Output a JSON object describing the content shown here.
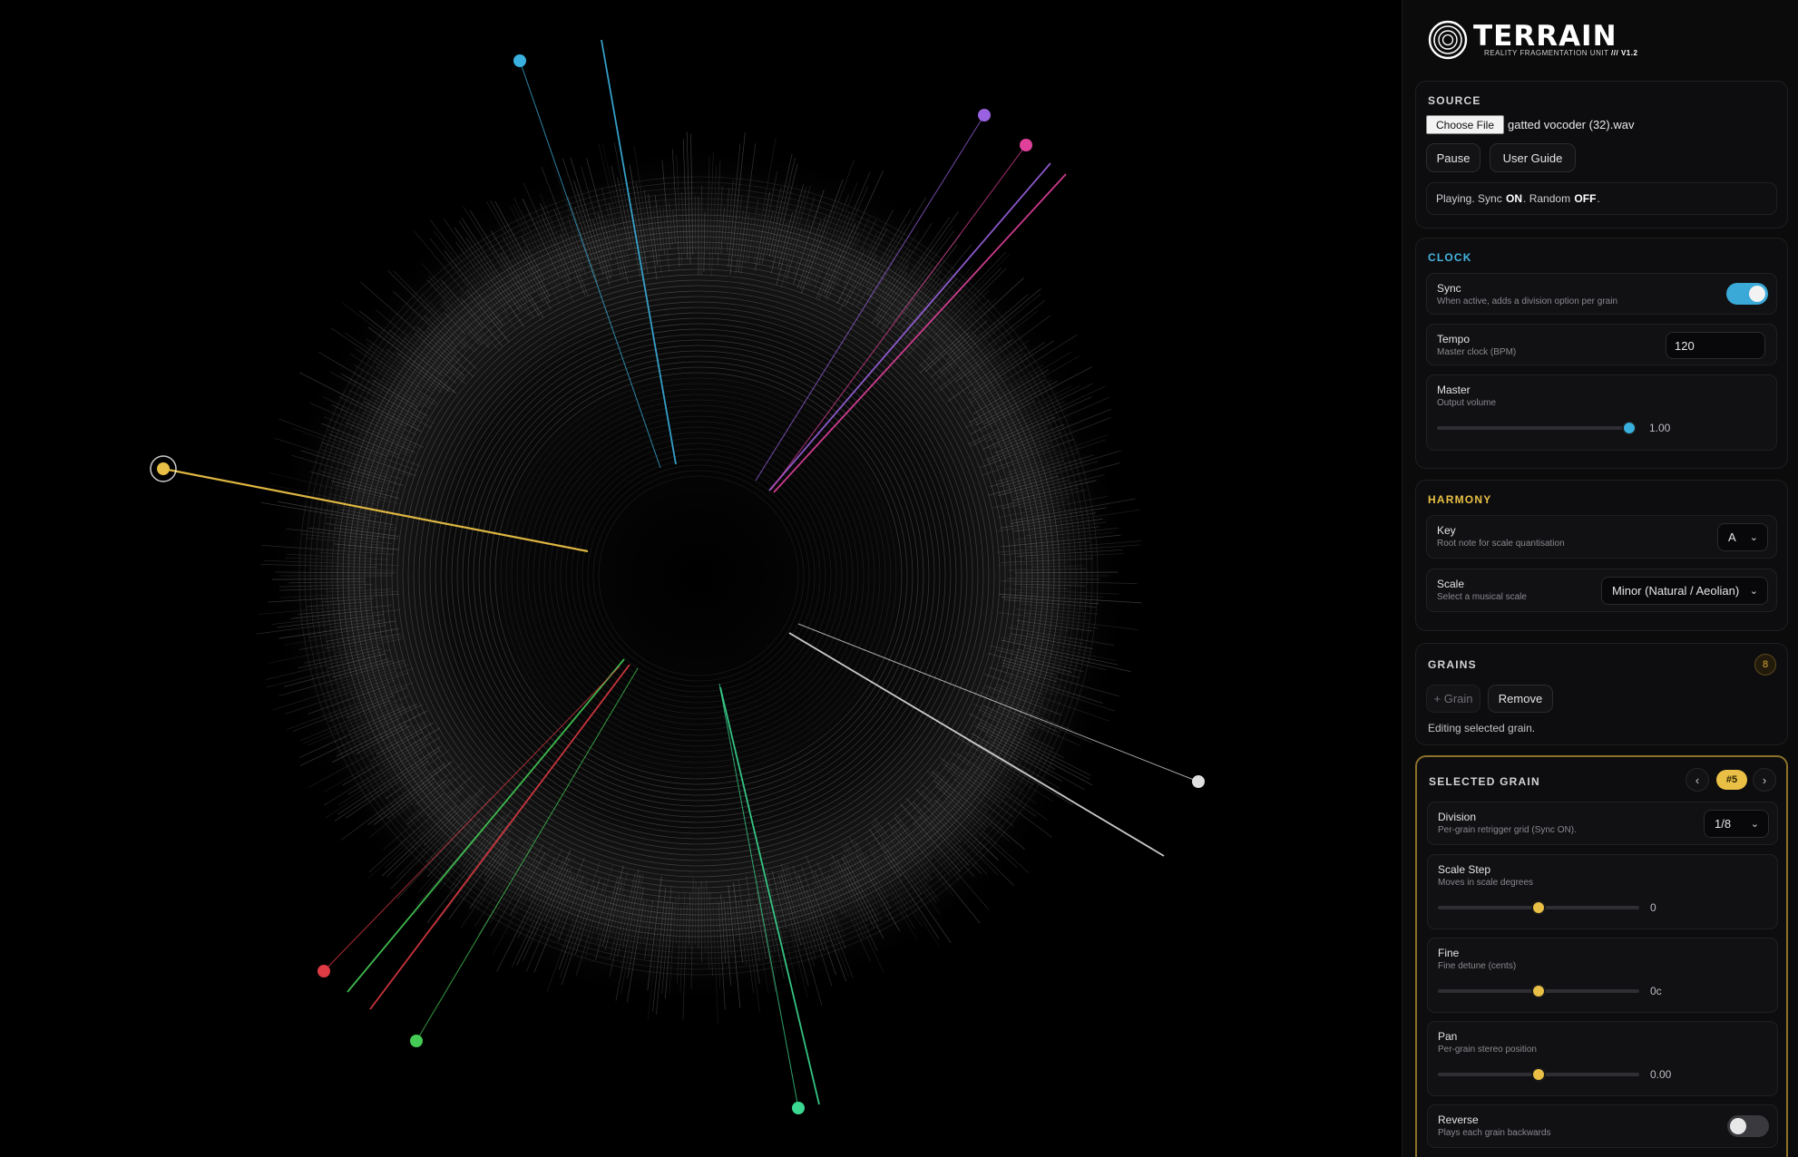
{
  "colors": {
    "accent_blue": "#3aa9d8",
    "accent_gold": "#e9c045",
    "clock_title": "#45b4e0",
    "harmony_title": "#e9c045",
    "selected_border": "#8c7128"
  },
  "brand": {
    "title": "TERRAIN",
    "subtitle": "REALITY FRAGMENTATION UNIT",
    "version": "/// V1.2"
  },
  "source": {
    "title": "SOURCE",
    "file_button": "Choose File",
    "file_name": "gatted vocoder (32).wav",
    "pause_label": "Pause",
    "guide_label": "User Guide",
    "status_prefix": "Playing. Sync",
    "status_sync": "ON",
    "status_mid": ". Random",
    "status_random": "OFF",
    "status_end": "."
  },
  "clock": {
    "title": "CLOCK",
    "sync_label": "Sync",
    "sync_desc": "When active, adds a division option per grain",
    "sync_on": true,
    "tempo_label": "Tempo",
    "tempo_desc": "Master clock (BPM)",
    "tempo_value": "120",
    "master_label": "Master",
    "master_desc": "Output volume",
    "master_value": "1.00",
    "master_fraction": 1.0
  },
  "harmony": {
    "title": "HARMONY",
    "key_label": "Key",
    "key_desc": "Root note for scale quantisation",
    "key_value": "A",
    "scale_label": "Scale",
    "scale_desc": "Select a musical scale",
    "scale_value": "Minor (Natural / Aeolian)"
  },
  "grains": {
    "title": "GRAINS",
    "count": "8",
    "add_label": "+ Grain",
    "remove_label": "Remove",
    "note": "Editing selected grain."
  },
  "selected_grain": {
    "title": "SELECTED GRAIN",
    "prev": "‹",
    "next": "›",
    "badge": "#5",
    "division_label": "Division",
    "division_desc": "Per-grain retrigger grid (Sync ON).",
    "division_value": "1/8",
    "scale_step_label": "Scale Step",
    "scale_step_desc": "Moves in scale degrees",
    "scale_step_value": "0",
    "scale_step_fraction": 0.5,
    "fine_label": "Fine",
    "fine_desc": "Fine detune (cents)",
    "fine_value": "0c",
    "fine_fraction": 0.5,
    "pan_label": "Pan",
    "pan_desc": "Per-grain stereo position",
    "pan_value": "0.00",
    "pan_fraction": 0.5,
    "reverse_label": "Reverse",
    "reverse_desc": "Plays each grain backwards",
    "reverse_on": false
  },
  "grain_colors": [
    "#e9c045",
    "#3ab0de",
    "#9a62e0",
    "#e0409a",
    "#e0e0e0",
    "#3ad890",
    "#44cc55",
    "#e03a44"
  ]
}
